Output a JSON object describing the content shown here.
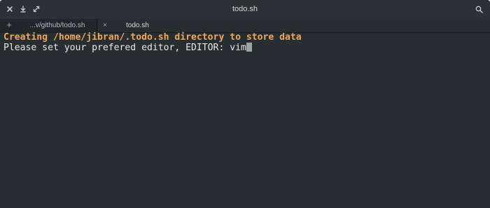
{
  "window": {
    "title": "todo.sh"
  },
  "titlebar_icons": {
    "close": "close-icon",
    "minimize": "download-icon",
    "maximize": "maximize-icon",
    "search": "search-icon"
  },
  "tabs": [
    {
      "label": "...v/github/todo.sh",
      "active": false
    },
    {
      "label": "todo.sh",
      "active": true,
      "close_glyph": "×"
    }
  ],
  "new_tab_glyph": "+",
  "terminal": {
    "lines": [
      "Creating /home/jibran/.todo.sh directory to store data",
      "Please set your prefered editor, EDITOR: vim"
    ],
    "colors": {
      "background": "#262e31",
      "info": "#f0a55a",
      "text": "#e6e8e8",
      "cursor": "#9aa6a4"
    }
  }
}
